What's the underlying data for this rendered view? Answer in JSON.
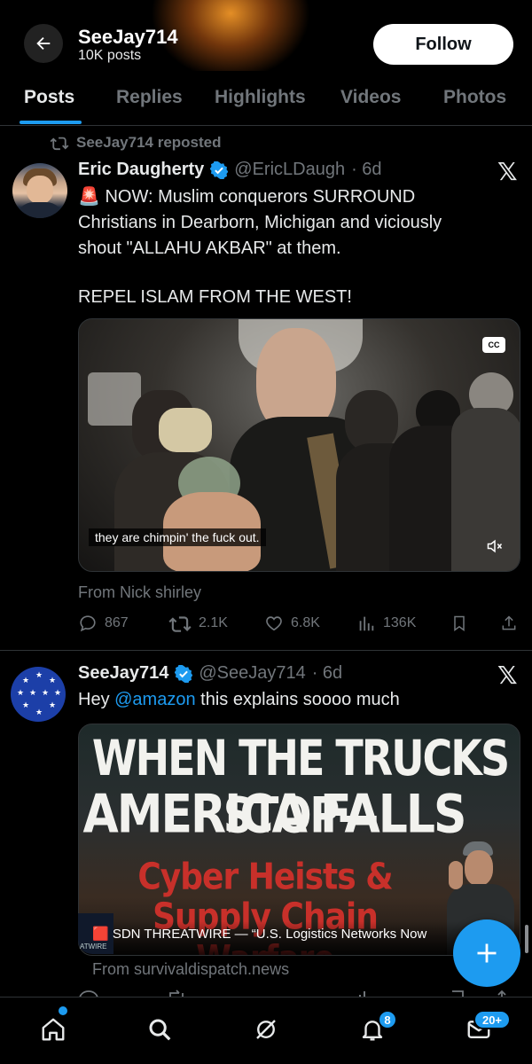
{
  "header": {
    "title": "SeeJay714",
    "subtitle": "10K posts",
    "follow_label": "Follow"
  },
  "tabs": [
    {
      "label": "Posts",
      "active": true
    },
    {
      "label": "Replies",
      "active": false
    },
    {
      "label": "Highlights",
      "active": false
    },
    {
      "label": "Videos",
      "active": false
    },
    {
      "label": "Photos",
      "active": false
    }
  ],
  "posts": [
    {
      "repost_label": "SeeJay714 reposted",
      "display_name": "Eric Daugherty",
      "handle": "@EricLDaugh",
      "time": "· 6d",
      "text_line1": "🚨 NOW: Muslim conquerors SURROUND",
      "text_line2": "Christians in Dearborn, Michigan and viciously",
      "text_line3": "shout \"ALLAHU AKBAR\" at them.",
      "text_line4": "REPEL ISLAM FROM THE WEST!",
      "media_caption": "they are chimpin' the fuck out.",
      "cc_label": "CC",
      "from_label": "From Nick shirley",
      "replies": "867",
      "reposts": "2.1K",
      "likes": "6.8K",
      "views": "136K"
    },
    {
      "display_name": "SeeJay714",
      "handle": "@SeeJay714",
      "time": "· 6d",
      "text_prefix": "Hey ",
      "mention": "@amazon",
      "text_suffix": " this explains soooo much",
      "thumb_line1": "WHEN THE TRUCKS STOP—",
      "thumb_line2": "AMERICA FALLS",
      "thumb_line3": "Cyber Heists &",
      "thumb_line4": "Supply Chain Warfare",
      "thumb_logo_text": "ATWIRE",
      "link_title": "🟥 SDN THREATWIRE — “U.S. Logistics Networks Now",
      "from_label": "From survivaldispatch.news"
    }
  ],
  "bottom_nav": {
    "notifications_badge": "8",
    "messages_badge": "20+"
  },
  "colors": {
    "accent": "#1d9bf0",
    "background": "#000000",
    "secondary_text": "#71767b"
  }
}
